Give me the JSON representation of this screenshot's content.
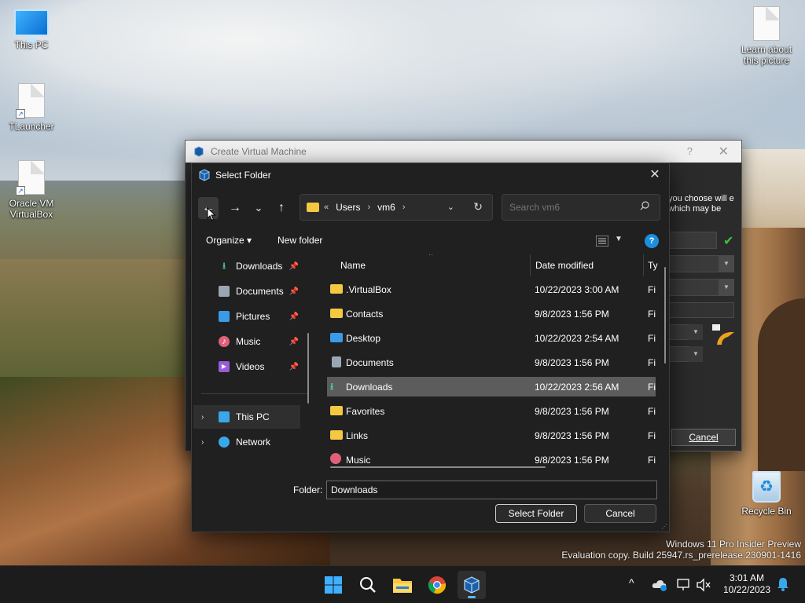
{
  "desktop": {
    "icons": [
      {
        "label": "This PC"
      },
      {
        "label": "TLauncher"
      },
      {
        "label": "Oracle VM VirtualBox"
      },
      {
        "label": "Learn about this picture"
      },
      {
        "label": "Recycle Bin"
      }
    ],
    "watermark": {
      "line1": "Windows 11 Pro Insider Preview",
      "line2": "Evaluation copy. Build 25947.rs_prerelease.230901-1416"
    }
  },
  "vm_window": {
    "title": "Create Virtual Machine",
    "help_label": "?",
    "close_label": "✕",
    "side_text": "you choose will e which may be",
    "cancel_label": "Cancel"
  },
  "dialog": {
    "title": "Select Folder",
    "close_label": "✕",
    "nav": {
      "back": "←",
      "forward": "→",
      "recent": "⌄",
      "up": "↑"
    },
    "address": {
      "overflow": "«",
      "segments": [
        "Users",
        "vm6"
      ],
      "separator": "›"
    },
    "search": {
      "placeholder": "Search vm6"
    },
    "toolbar": {
      "organize": "Organize ▾",
      "new_folder": "New folder"
    },
    "nav_pane": {
      "quick_access": [
        {
          "label": "Downloads",
          "icon": "download-icon",
          "color": "#4ec9a0"
        },
        {
          "label": "Documents",
          "icon": "document-icon",
          "color": "#9aa6b4"
        },
        {
          "label": "Pictures",
          "icon": "pictures-icon",
          "color": "#3a9be8"
        },
        {
          "label": "Music",
          "icon": "music-icon",
          "color": "#e0607a"
        },
        {
          "label": "Videos",
          "icon": "videos-icon",
          "color": "#9b5ad8"
        }
      ],
      "locations": [
        {
          "label": "This PC",
          "icon": "this-pc-icon",
          "color": "#3aa7e8",
          "selected": true
        },
        {
          "label": "Network",
          "icon": "network-icon",
          "color": "#3aa7e8",
          "selected": false
        }
      ]
    },
    "columns": {
      "name": "Name",
      "date": "Date modified",
      "type": "Ty"
    },
    "files": [
      {
        "name": ".VirtualBox",
        "date": "10/22/2023 3:00 AM",
        "type": "Fi",
        "icon": "folder-icon",
        "color": "#f5c842"
      },
      {
        "name": "Contacts",
        "date": "9/8/2023 1:56 PM",
        "type": "Fi",
        "icon": "folder-icon",
        "color": "#f5c842"
      },
      {
        "name": "Desktop",
        "date": "10/22/2023 2:54 AM",
        "type": "Fi",
        "icon": "desktop-folder-icon",
        "color": "#3a9be8"
      },
      {
        "name": "Documents",
        "date": "9/8/2023 1:56 PM",
        "type": "Fi",
        "icon": "documents-folder-icon",
        "color": "#9aa6b4"
      },
      {
        "name": "Downloads",
        "date": "10/22/2023 2:56 AM",
        "type": "Fi",
        "icon": "downloads-folder-icon",
        "color": "#4ec9a0",
        "selected": true
      },
      {
        "name": "Favorites",
        "date": "9/8/2023 1:56 PM",
        "type": "Fi",
        "icon": "folder-icon",
        "color": "#f5c842"
      },
      {
        "name": "Links",
        "date": "9/8/2023 1:56 PM",
        "type": "Fi",
        "icon": "folder-icon",
        "color": "#f5c842"
      },
      {
        "name": "Music",
        "date": "9/8/2023 1:56 PM",
        "type": "Fi",
        "icon": "music-folder-icon",
        "color": "#e0607a"
      }
    ],
    "folder_label": "Folder:",
    "folder_value": "Downloads",
    "select_button": "Select Folder",
    "cancel_button": "Cancel"
  },
  "taskbar": {
    "apps": [
      "start-icon",
      "search-icon",
      "file-explorer-icon",
      "chrome-icon",
      "virtualbox-icon"
    ],
    "clock": {
      "time": "3:01 AM",
      "date": "10/22/2023"
    },
    "tray_chevron": "^"
  }
}
